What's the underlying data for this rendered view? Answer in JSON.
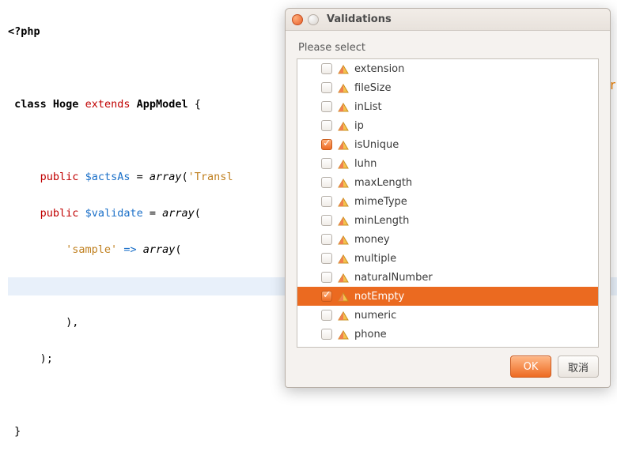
{
  "code": {
    "open_tag": "<?php",
    "kw_class": "class",
    "class_name": "Hoge",
    "kw_extends": "extends",
    "super_name": "AppModel",
    "brace_open": "{",
    "kw_public1": "public",
    "var_actsAs": "$actsAs",
    "eq": "=",
    "fn_array": "array",
    "str_transl": "'Transl",
    "kw_public2": "public",
    "var_validate": "$validate",
    "str_sample": "'sample'",
    "arrow": "=>",
    "close_arr1": "),",
    "close_arr2": ");",
    "brace_close": "}",
    "truncated_right": "Sear"
  },
  "dialog": {
    "title": "Validations",
    "prompt": "Please select",
    "ok": "OK",
    "cancel": "取消",
    "items": [
      {
        "label": "extension",
        "checked": false
      },
      {
        "label": "fileSize",
        "checked": false
      },
      {
        "label": "inList",
        "checked": false
      },
      {
        "label": "ip",
        "checked": false
      },
      {
        "label": "isUnique",
        "checked": true
      },
      {
        "label": "luhn",
        "checked": false
      },
      {
        "label": "maxLength",
        "checked": false
      },
      {
        "label": "mimeType",
        "checked": false
      },
      {
        "label": "minLength",
        "checked": false
      },
      {
        "label": "money",
        "checked": false
      },
      {
        "label": "multiple",
        "checked": false
      },
      {
        "label": "naturalNumber",
        "checked": false
      },
      {
        "label": "notEmpty",
        "checked": true,
        "selected": true
      },
      {
        "label": "numeric",
        "checked": false
      },
      {
        "label": "phone",
        "checked": false
      }
    ]
  }
}
